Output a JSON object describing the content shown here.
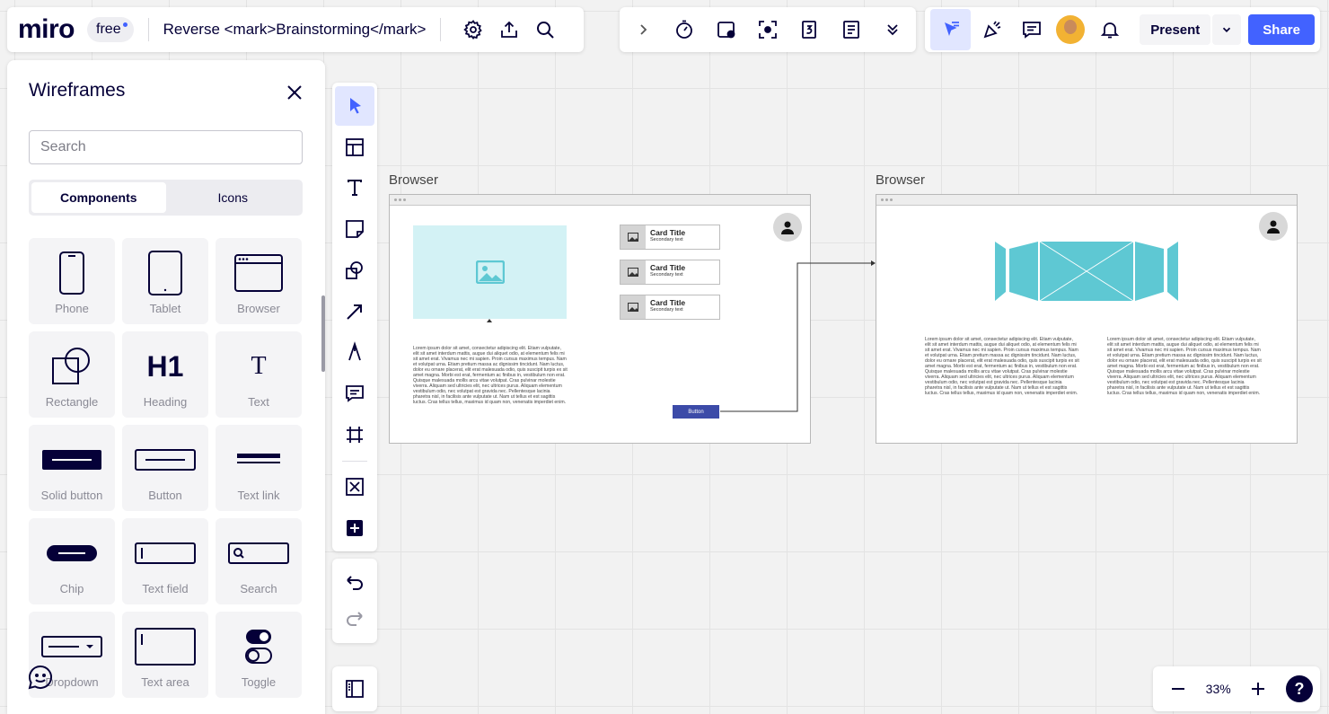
{
  "app": {
    "logo": "miro",
    "plan": "free",
    "board_title": "Reverse <mark>Brainstorming</mark>"
  },
  "topbar_right": {
    "present_label": "Present",
    "share_label": "Share"
  },
  "wireframes_panel": {
    "title": "Wireframes",
    "search_placeholder": "Search",
    "tabs": [
      "Components",
      "Icons"
    ],
    "components": [
      {
        "label": "Phone",
        "icon": "phone-icon"
      },
      {
        "label": "Tablet",
        "icon": "tablet-icon"
      },
      {
        "label": "Browser",
        "icon": "browser-icon"
      },
      {
        "label": "Rectangle",
        "icon": "rectangle-icon"
      },
      {
        "label": "Heading",
        "icon": "heading-icon",
        "glyph": "H1"
      },
      {
        "label": "Text",
        "icon": "text-icon",
        "glyph": "T"
      },
      {
        "label": "Solid button",
        "icon": "solid-button-icon"
      },
      {
        "label": "Button",
        "icon": "button-icon"
      },
      {
        "label": "Text link",
        "icon": "text-link-icon"
      },
      {
        "label": "Chip",
        "icon": "chip-icon"
      },
      {
        "label": "Text field",
        "icon": "text-field-icon"
      },
      {
        "label": "Search",
        "icon": "search-field-icon"
      },
      {
        "label": "Dropdown",
        "icon": "dropdown-icon"
      },
      {
        "label": "Text area",
        "icon": "text-area-icon"
      },
      {
        "label": "Toggle",
        "icon": "toggle-icon"
      }
    ]
  },
  "zoom": {
    "level": "33%",
    "help": "?"
  },
  "canvas": {
    "frame1": {
      "label": "Browser",
      "cards": [
        {
          "title": "Card Title",
          "subtitle": "Secondary text"
        },
        {
          "title": "Card Title",
          "subtitle": "Secondary text"
        },
        {
          "title": "Card Title",
          "subtitle": "Secondary text"
        }
      ],
      "button_label": "Button",
      "lorem": "Lorem ipsum dolor sit amet, consectetur adipiscing elit. Etiam vulputate, elit sit amet interdum mattis, augue dui aliquet odio, at elementum felis mi sit amet erat. Vivamus nec mi sapien. Proin cursus maximus tempus. Nam et volutpat urna. Etiam pretium massa ac dignissim tincidunt. Nam luctus, dolor eu ornare placerat, elit erat malesuada odio, quis suscipit turpis ex sit amet magna. Morbi est erat, fermentum ac finibus in, vestibulum non erat. Quisque malesuada mollis arcu vitae volutpat. Cras pulvinar molestie viverra. Aliquam sed ultricies elit, nec ultrices purus. Aliquam elementum vestibulum odio, nec volutpat est gravida nec. Pellentesque lacinia pharetra nisl, in facilisis ante vulputate ut. Nam ut tellus et est sagittis luctus. Cras tellus tellus, maximus id quam non, venenatis imperdiet enim."
    },
    "frame2": {
      "label": "Browser",
      "lorem_left": "Lorem ipsum dolor sit amet, consectetur adipiscing elit. Etiam vulputate, elit sit amet interdum mattis, augue dui aliquet odio, at elementum felis mi sit amet erat. Vivamus nec mi sapien. Proin cursus maximus tempus. Nam et volutpat urna. Etiam pretium massa ac dignissim tincidunt. Nam luctus, dolor eu ornare placerat, elit erat malesuada odio, quis suscipit turpis ex sit amet magna. Morbi est erat, fermentum ac finibus in, vestibulum non erat. Quisque malesuada mollis arcu vitae volutpat. Cras pulvinar molestie viverra. Aliquam sed ultricies elit, nec ultrices purus. Aliquam elementum vestibulum odio, nec volutpat est gravida nec. Pellentesque lacinia pharetra nisl, in facilisis ante vulputate ut. Nam ut tellus et est sagittis luctus. Cras tellus tellus, maximus id quam non, venenatis imperdiet enim.",
      "lorem_right": "Lorem ipsum dolor sit amet, consectetur adipiscing elit. Etiam vulputate, elit sit amet interdum mattis, augue dui aliquet odio, at elementum felis mi sit amet erat. Vivamus nec mi sapien. Proin cursus maximus tempus. Nam et volutpat urna. Etiam pretium massa ac dignissim tincidunt. Nam luctus, dolor eu ornare placerat, elit erat malesuada odio, quis suscipit turpis ex sit amet magna. Morbi est erat, fermentum ac finibus in, vestibulum non erat. Quisque malesuada mollis arcu vitae volutpat. Cras pulvinar molestie viverra. Aliquam sed ultricies elit, nec ultrices purus. Aliquam elementum vestibulum odio, nec volutpat est gravida nec. Pellentesque lacinia pharetra nisl, in facilisis ante vulputate ut. Nam ut tellus et est sagittis luctus. Cras tellus tellus, maximus id quam non, venenatis imperdiet enim."
    }
  },
  "colors": {
    "accent": "#4262ff",
    "ink": "#050038",
    "wire_teal": "#5ec8d3",
    "wire_button": "#3c4ba8"
  }
}
